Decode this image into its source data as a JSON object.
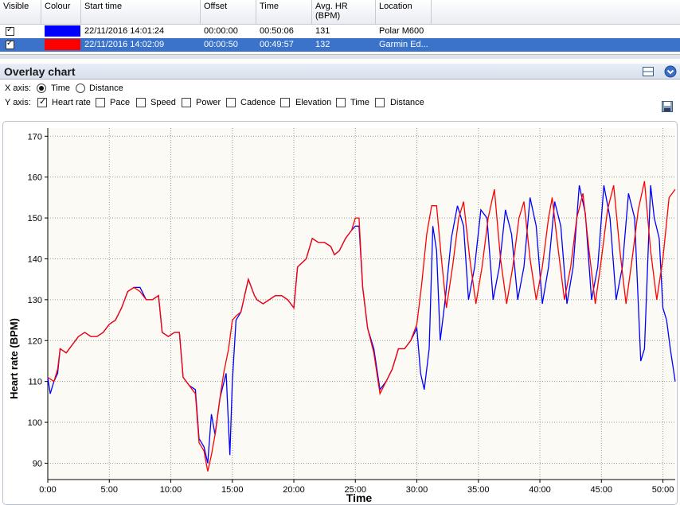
{
  "grid": {
    "columns": [
      "Visible",
      "Colour",
      "Start time",
      "Offset",
      "Time",
      "Avg. HR (BPM)",
      "Location"
    ],
    "rows": [
      {
        "start": "22/11/2016 14:01:24",
        "offset": "00:00:00",
        "time": "00:50:06",
        "hr": "131",
        "location": "Polar M600",
        "color": "#0000ff"
      },
      {
        "start": "22/11/2016 14:02:09",
        "offset": "00:00:50",
        "time": "00:49:57",
        "hr": "132",
        "location": "Garmin Ed...",
        "color": "#ff0000"
      }
    ]
  },
  "panel": {
    "title": "Overlay chart"
  },
  "options": {
    "xaxis_label": "X axis:",
    "x_time": "Time",
    "x_distance": "Distance",
    "yaxis_label": "Y axis:",
    "y_items": [
      "Heart rate",
      "Pace",
      "Speed",
      "Power",
      "Cadence",
      "Elevation",
      "Time",
      "Distance"
    ]
  },
  "chart_data": {
    "type": "line",
    "xlabel": "Time",
    "ylabel": "Heart rate (BPM)",
    "xticks": [
      "0:00",
      "5:00",
      "10:00",
      "15:00",
      "20:00",
      "25:00",
      "30:00",
      "35:00",
      "40:00",
      "45:00",
      "50:00"
    ],
    "yticks": [
      90,
      100,
      110,
      120,
      130,
      140,
      150,
      160,
      170
    ],
    "xlim": [
      0,
      51
    ],
    "ylim": [
      86,
      172
    ],
    "grid": true,
    "series": [
      {
        "color": "#0000ff",
        "points": [
          [
            0,
            111
          ],
          [
            0.2,
            107
          ],
          [
            0.5,
            110
          ],
          [
            0.8,
            112
          ],
          [
            1.0,
            118
          ],
          [
            1.5,
            117
          ],
          [
            2,
            119
          ],
          [
            2.5,
            121
          ],
          [
            3,
            122
          ],
          [
            3.5,
            121
          ],
          [
            4,
            121
          ],
          [
            4.5,
            122
          ],
          [
            5,
            124
          ],
          [
            5.5,
            125
          ],
          [
            6,
            128
          ],
          [
            6.5,
            132
          ],
          [
            7,
            133
          ],
          [
            7.5,
            133
          ],
          [
            8,
            130
          ],
          [
            8.5,
            130
          ],
          [
            9,
            131
          ],
          [
            9.3,
            122
          ],
          [
            9.8,
            121
          ],
          [
            10.3,
            122
          ],
          [
            10.7,
            122
          ],
          [
            11,
            111
          ],
          [
            11.5,
            109
          ],
          [
            12,
            108
          ],
          [
            12.3,
            96
          ],
          [
            12.7,
            94
          ],
          [
            13,
            90
          ],
          [
            13.3,
            102
          ],
          [
            13.6,
            97
          ],
          [
            14,
            106
          ],
          [
            14.5,
            112
          ],
          [
            14.8,
            92
          ],
          [
            15,
            110
          ],
          [
            15.3,
            125
          ],
          [
            15.7,
            127
          ],
          [
            16,
            131
          ],
          [
            16.3,
            135
          ],
          [
            16.8,
            131
          ],
          [
            17,
            130
          ],
          [
            17.5,
            129
          ],
          [
            18,
            130
          ],
          [
            18.5,
            131
          ],
          [
            19,
            131
          ],
          [
            19.5,
            130
          ],
          [
            20,
            128
          ],
          [
            20.3,
            138
          ],
          [
            21,
            140
          ],
          [
            21.5,
            145
          ],
          [
            22,
            144
          ],
          [
            22.5,
            144
          ],
          [
            23,
            143
          ],
          [
            23.3,
            141
          ],
          [
            23.7,
            142
          ],
          [
            24.2,
            145
          ],
          [
            24.7,
            147
          ],
          [
            25,
            148
          ],
          [
            25.3,
            148
          ],
          [
            25.6,
            133
          ],
          [
            26,
            123
          ],
          [
            26.5,
            118
          ],
          [
            27,
            108
          ],
          [
            27.5,
            110
          ],
          [
            28,
            113
          ],
          [
            28.5,
            118
          ],
          [
            29,
            118
          ],
          [
            29.5,
            120
          ],
          [
            30,
            123
          ],
          [
            30.3,
            112
          ],
          [
            30.6,
            108
          ],
          [
            31,
            118
          ],
          [
            31.3,
            148
          ],
          [
            31.6,
            142
          ],
          [
            31.9,
            120
          ],
          [
            32.3,
            130
          ],
          [
            32.8,
            145
          ],
          [
            33.3,
            153
          ],
          [
            33.8,
            148
          ],
          [
            34.2,
            130
          ],
          [
            34.7,
            138
          ],
          [
            35.2,
            152
          ],
          [
            35.7,
            150
          ],
          [
            36.2,
            130
          ],
          [
            36.7,
            138
          ],
          [
            37.2,
            152
          ],
          [
            37.7,
            146
          ],
          [
            38.2,
            130
          ],
          [
            38.7,
            138
          ],
          [
            39.2,
            155
          ],
          [
            39.7,
            148
          ],
          [
            40.2,
            129
          ],
          [
            40.7,
            138
          ],
          [
            41.2,
            154
          ],
          [
            41.7,
            148
          ],
          [
            42.2,
            129
          ],
          [
            42.7,
            138
          ],
          [
            43.2,
            158
          ],
          [
            43.7,
            151
          ],
          [
            44.2,
            130
          ],
          [
            44.7,
            138
          ],
          [
            45.2,
            158
          ],
          [
            45.7,
            150
          ],
          [
            46.2,
            130
          ],
          [
            46.7,
            138
          ],
          [
            47.2,
            156
          ],
          [
            47.7,
            150
          ],
          [
            48.2,
            115
          ],
          [
            48.5,
            118
          ],
          [
            49.0,
            158
          ],
          [
            49.3,
            150
          ],
          [
            49.7,
            145
          ],
          [
            50.0,
            128
          ],
          [
            50.3,
            125
          ],
          [
            50.6,
            118
          ],
          [
            51,
            110
          ]
        ]
      },
      {
        "color": "#ff0000",
        "points": [
          [
            0,
            111
          ],
          [
            0.5,
            110
          ],
          [
            0.8,
            113
          ],
          [
            1.0,
            118
          ],
          [
            1.5,
            117
          ],
          [
            2,
            119
          ],
          [
            2.5,
            121
          ],
          [
            3,
            122
          ],
          [
            3.5,
            121
          ],
          [
            4,
            121
          ],
          [
            4.5,
            122
          ],
          [
            5,
            124
          ],
          [
            5.5,
            125
          ],
          [
            6,
            128
          ],
          [
            6.5,
            132
          ],
          [
            7,
            133
          ],
          [
            7.5,
            132
          ],
          [
            8,
            130
          ],
          [
            8.5,
            130
          ],
          [
            9,
            131
          ],
          [
            9.3,
            122
          ],
          [
            9.8,
            121
          ],
          [
            10.3,
            122
          ],
          [
            10.7,
            122
          ],
          [
            11,
            111
          ],
          [
            11.5,
            109
          ],
          [
            12,
            107
          ],
          [
            12.3,
            95
          ],
          [
            12.7,
            93
          ],
          [
            13,
            88
          ],
          [
            13.3,
            92
          ],
          [
            13.6,
            97
          ],
          [
            14,
            106
          ],
          [
            14.3,
            112
          ],
          [
            14.7,
            118
          ],
          [
            15.0,
            125
          ],
          [
            15.3,
            126
          ],
          [
            15.7,
            127
          ],
          [
            16,
            131
          ],
          [
            16.3,
            135
          ],
          [
            16.8,
            131
          ],
          [
            17,
            130
          ],
          [
            17.5,
            129
          ],
          [
            18,
            130
          ],
          [
            18.5,
            131
          ],
          [
            19,
            131
          ],
          [
            19.5,
            130
          ],
          [
            20,
            128
          ],
          [
            20.3,
            138
          ],
          [
            21,
            140
          ],
          [
            21.5,
            145
          ],
          [
            22,
            144
          ],
          [
            22.5,
            144
          ],
          [
            23,
            143
          ],
          [
            23.3,
            141
          ],
          [
            23.7,
            142
          ],
          [
            24.2,
            145
          ],
          [
            24.7,
            147
          ],
          [
            25,
            150
          ],
          [
            25.3,
            150
          ],
          [
            25.6,
            133
          ],
          [
            26,
            123
          ],
          [
            26.5,
            117
          ],
          [
            27,
            107
          ],
          [
            27.5,
            110
          ],
          [
            28,
            113
          ],
          [
            28.5,
            118
          ],
          [
            29,
            118
          ],
          [
            29.5,
            120
          ],
          [
            30,
            124
          ],
          [
            30.4,
            134
          ],
          [
            30.8,
            146
          ],
          [
            31.2,
            153
          ],
          [
            31.6,
            153
          ],
          [
            32,
            140
          ],
          [
            32.4,
            128
          ],
          [
            32.9,
            138
          ],
          [
            33.4,
            150
          ],
          [
            33.8,
            154
          ],
          [
            34.3,
            140
          ],
          [
            34.8,
            129
          ],
          [
            35.3,
            138
          ],
          [
            35.8,
            150
          ],
          [
            36.3,
            157
          ],
          [
            36.8,
            140
          ],
          [
            37.3,
            129
          ],
          [
            37.8,
            138
          ],
          [
            38.3,
            150
          ],
          [
            38.7,
            154
          ],
          [
            39.2,
            140
          ],
          [
            39.7,
            130
          ],
          [
            40.2,
            138
          ],
          [
            40.7,
            150
          ],
          [
            41.0,
            155
          ],
          [
            41.5,
            142
          ],
          [
            42.0,
            130
          ],
          [
            42.5,
            138
          ],
          [
            43.0,
            150
          ],
          [
            43.5,
            156
          ],
          [
            44.0,
            142
          ],
          [
            44.5,
            129
          ],
          [
            45.0,
            140
          ],
          [
            45.5,
            152
          ],
          [
            46.0,
            158
          ],
          [
            46.5,
            142
          ],
          [
            47.0,
            129
          ],
          [
            47.5,
            140
          ],
          [
            48.0,
            152
          ],
          [
            48.5,
            159
          ],
          [
            49.0,
            142
          ],
          [
            49.5,
            130
          ],
          [
            50.0,
            140
          ],
          [
            50.5,
            155
          ],
          [
            51,
            157
          ]
        ]
      }
    ]
  }
}
